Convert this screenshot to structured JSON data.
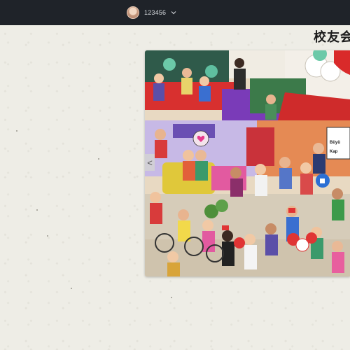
{
  "header": {
    "username": "123456",
    "avatar_icon": "avatar-icon",
    "dropdown_icon": "chevron-down-icon"
  },
  "page": {
    "title": "校友会"
  },
  "carousel": {
    "prev_label": "<",
    "sign_text": "Büyü Kap"
  }
}
